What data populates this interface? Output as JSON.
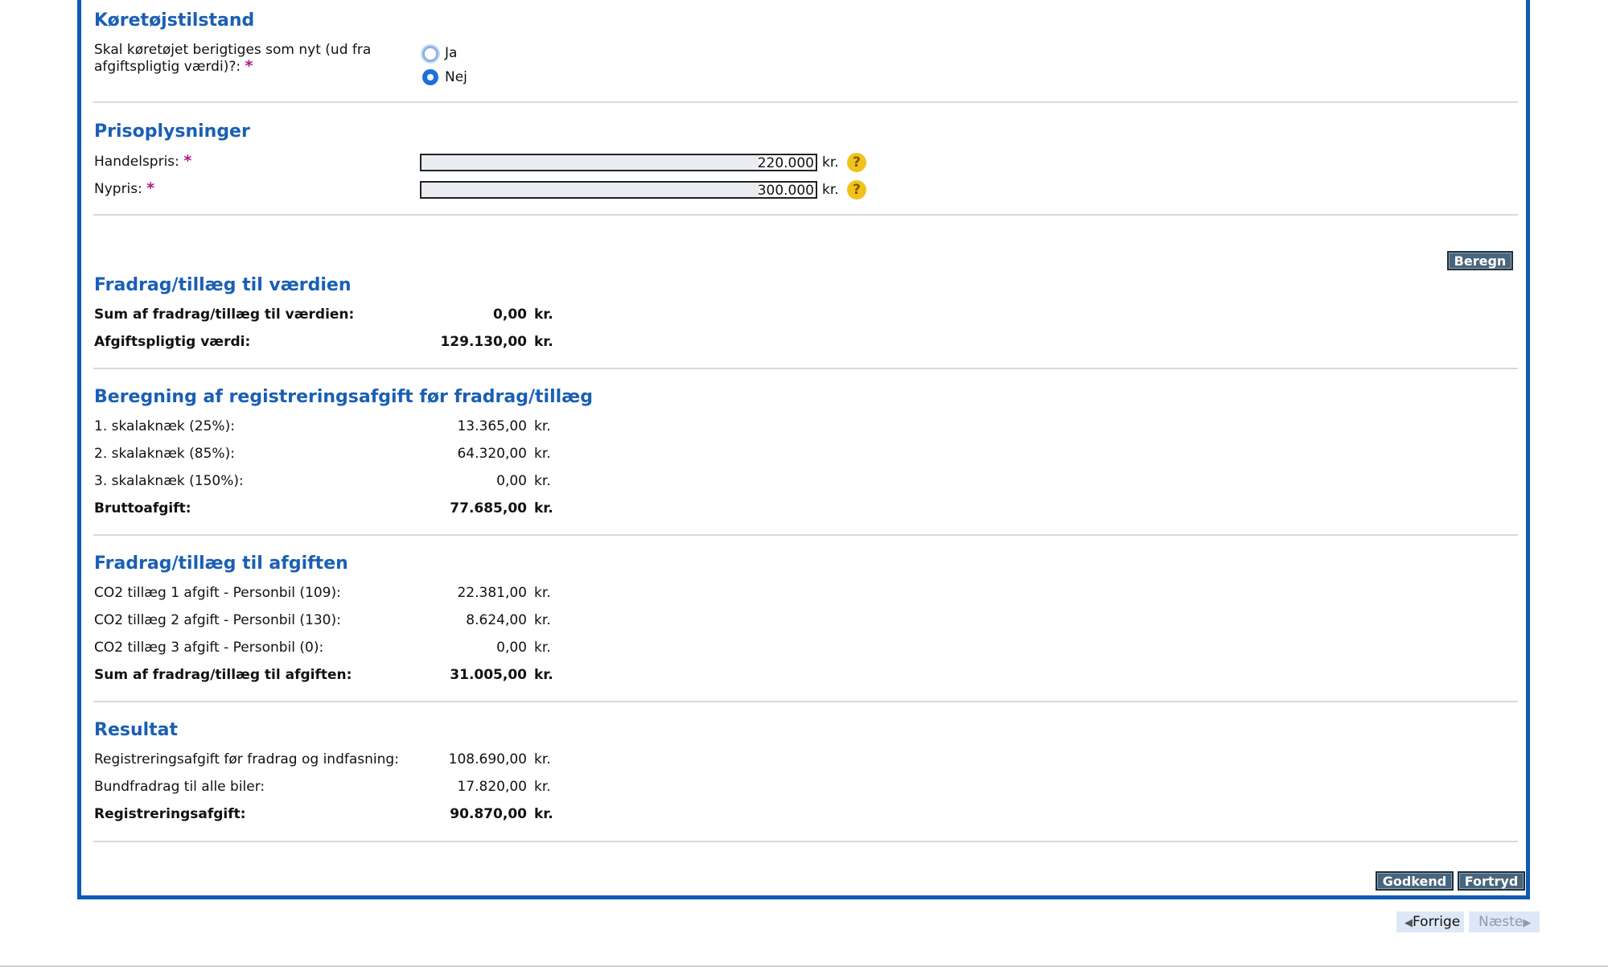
{
  "vehicle_condition": {
    "title": "Køretøjstilstand",
    "question_line1": "Skal køretøjet berigtiges som nyt (ud fra",
    "question_line2": "afgiftspligtig værdi)?:",
    "required_mark": "*",
    "options": [
      "Ja",
      "Nej"
    ],
    "selected": "Nej"
  },
  "price_info": {
    "title": "Prisoplysninger",
    "trade_price_label": "Handelspris:",
    "trade_price_value": "220.000",
    "new_price_label": "Nypris:",
    "new_price_value": "300.000",
    "unit": "kr.",
    "required_mark": "*",
    "help_glyph": "?"
  },
  "calculate_button": "Beregn",
  "value_adjustments": {
    "title": "Fradrag/tillæg til værdien",
    "rows": [
      {
        "label": "Sum af fradrag/tillæg til værdien:",
        "value": "0,00",
        "unit": "kr."
      },
      {
        "label": "Afgiftspligtig værdi:",
        "value": "129.130,00",
        "unit": "kr."
      }
    ]
  },
  "tax_before": {
    "title": "Beregning af registreringsafgift før fradrag/tillæg",
    "rows": [
      {
        "label": "1. skalaknæk (25%):",
        "value": "13.365,00",
        "unit": "kr."
      },
      {
        "label": "2. skalaknæk (85%):",
        "value": "64.320,00",
        "unit": "kr."
      },
      {
        "label": "3. skalaknæk (150%):",
        "value": "0,00",
        "unit": "kr."
      },
      {
        "label": "Bruttoafgift:",
        "value": "77.685,00",
        "unit": "kr."
      }
    ]
  },
  "tax_adjustments": {
    "title": "Fradrag/tillæg til afgiften",
    "rows": [
      {
        "label": "CO2 tillæg 1 afgift - Personbil (109):",
        "value": "22.381,00",
        "unit": "kr."
      },
      {
        "label": "CO2 tillæg 2 afgift - Personbil (130):",
        "value": "8.624,00",
        "unit": "kr."
      },
      {
        "label": "CO2 tillæg 3 afgift - Personbil (0):",
        "value": "0,00",
        "unit": "kr."
      },
      {
        "label": "Sum af fradrag/tillæg til afgiften:",
        "value": "31.005,00",
        "unit": "kr."
      }
    ]
  },
  "result": {
    "title": "Resultat",
    "rows": [
      {
        "label": "Registreringsafgift før fradrag og indfasning:",
        "value": "108.690,00",
        "unit": "kr."
      },
      {
        "label": "Bundfradrag til alle biler:",
        "value": "17.820,00",
        "unit": "kr."
      },
      {
        "label": "Registreringsafgift:",
        "value": "90.870,00",
        "unit": "kr."
      }
    ]
  },
  "actions": {
    "approve": "Godkend",
    "cancel": "Fortryd"
  },
  "navigation": {
    "previous": "Forrige",
    "next": "Næste"
  },
  "colors": {
    "heading": "#1a5fb4",
    "border": "#0d5bb5",
    "required": "#b0168a",
    "button_bg": "#48657c",
    "help_icon": "#f2c21b"
  }
}
